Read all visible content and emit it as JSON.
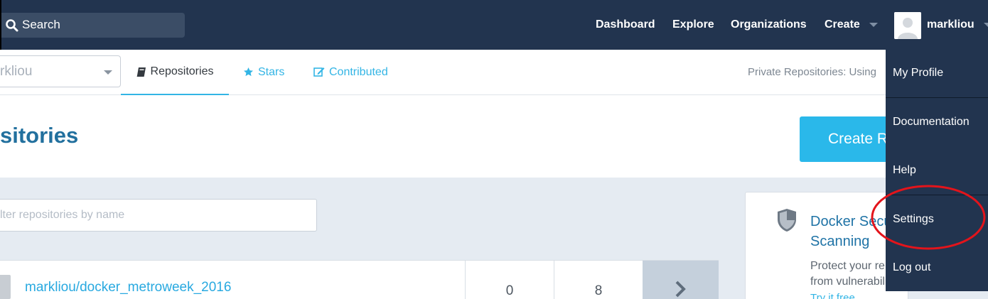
{
  "topnav": {
    "search_placeholder": "Search",
    "links": {
      "dashboard": "Dashboard",
      "explore": "Explore",
      "organizations": "Organizations",
      "create": "Create"
    },
    "username": "markliou",
    "background_color": "#22344f"
  },
  "subnav": {
    "namespace_value": "rkliou",
    "tabs": {
      "repositories": "Repositories",
      "stars": "Stars",
      "contributed": "Contributed"
    },
    "private_repos_text": "Private Repositories:  Using"
  },
  "page": {
    "title": "sitories",
    "create_button": "Create R"
  },
  "filter": {
    "placeholder": "lter repositories by name"
  },
  "repositories": [
    {
      "name": "markliou/docker_metroweek_2016",
      "stars": "0",
      "pulls": "8"
    }
  ],
  "promo": {
    "title": "Docker Secu Scanning",
    "text_line1": "Protect your re",
    "text_line2": "from vulnerabili",
    "link": "Try it free"
  },
  "user_menu": {
    "items": [
      "My Profile",
      "Documentation",
      "Help",
      "Settings",
      "Log out"
    ]
  },
  "colors": {
    "accent": "#33b5e5",
    "highlight_ring": "#e3141b",
    "title": "#22709e"
  },
  "icons": [
    "search-icon",
    "book-icon",
    "star-icon",
    "edit-icon",
    "chevron-down-icon",
    "chevron-right-icon",
    "shield-icon",
    "user-avatar-icon"
  ]
}
